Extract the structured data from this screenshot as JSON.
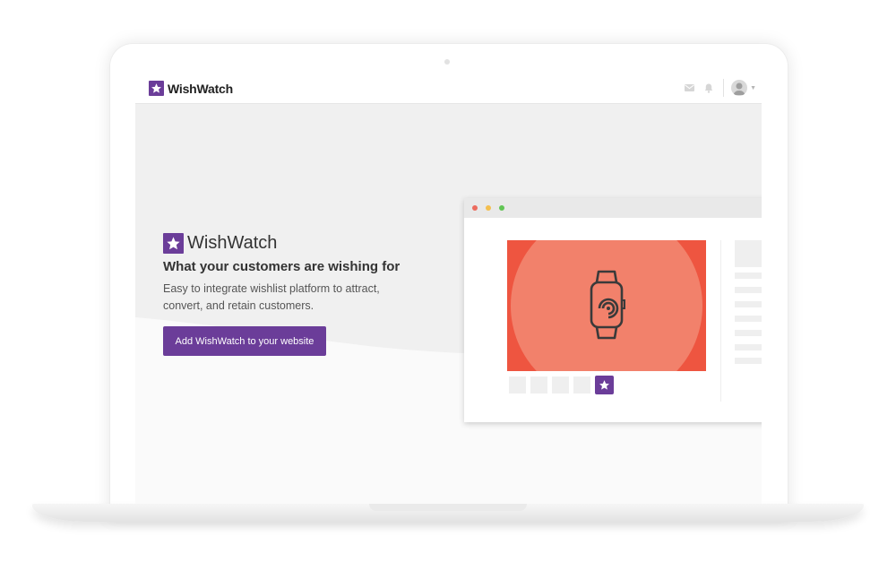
{
  "app": {
    "brand_name": "WishWatch",
    "brand_color": "#6b3d99"
  },
  "header": {
    "icons": [
      "mail-icon",
      "bell-icon",
      "user-avatar-icon",
      "chevron-down-icon"
    ]
  },
  "hero": {
    "brand_name": "WishWatch",
    "tagline": "What your customers are wishing for",
    "description": "Easy to integrate wishlist platform to attract, convert, and retain customers.",
    "cta_label": "Add WishWatch to your website"
  },
  "mock_browser": {
    "window_dots": [
      "#ec6b5e",
      "#f4bf4f",
      "#61c554"
    ],
    "product_image": "smartwatch-icon",
    "accent_color": "#ee5540"
  }
}
